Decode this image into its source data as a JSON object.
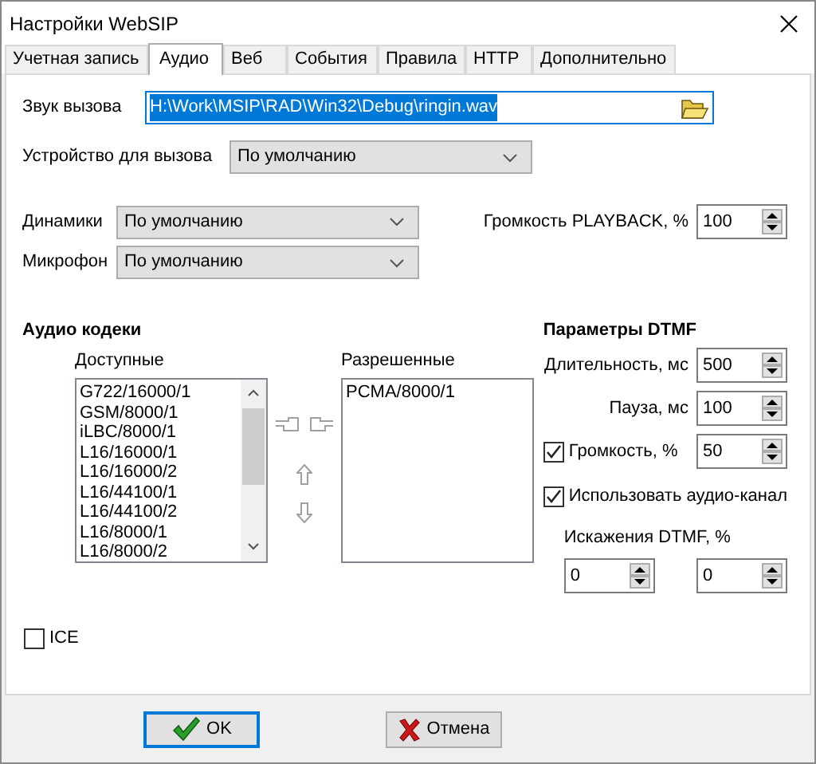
{
  "window": {
    "title": "Настройки WebSIP"
  },
  "tabs": [
    {
      "label": "Учетная запись",
      "selected": false
    },
    {
      "label": "Аудио",
      "selected": true
    },
    {
      "label": "Веб",
      "selected": false
    },
    {
      "label": "События",
      "selected": false
    },
    {
      "label": "Правила",
      "selected": false
    },
    {
      "label": "HTTP",
      "selected": false
    },
    {
      "label": "Дополнительно",
      "selected": false
    }
  ],
  "ring_sound": {
    "label": "Звук вызова",
    "value": "H:\\Work\\MSIP\\RAD\\Win32\\Debug\\ringin.wav",
    "selected": true
  },
  "ring_device": {
    "label": "Устройство для вызова",
    "value": "По умолчанию"
  },
  "speakers": {
    "label": "Динамики",
    "value": "По умолчанию"
  },
  "microphone": {
    "label": "Микрофон",
    "value": "По умолчанию"
  },
  "playback_volume": {
    "label": "Громкость PLAYBACK, %",
    "value": "100"
  },
  "codecs": {
    "title": "Аудио кодеки",
    "available": {
      "label": "Доступные",
      "items": [
        "G722/16000/1",
        "GSM/8000/1",
        "iLBC/8000/1",
        "L16/16000/1",
        "L16/16000/2",
        "L16/44100/1",
        "L16/44100/2",
        "L16/8000/1",
        "L16/8000/2"
      ]
    },
    "allowed": {
      "label": "Разрешенные",
      "items": [
        "PCMA/8000/1"
      ]
    }
  },
  "dtmf": {
    "title": "Параметры DTMF",
    "duration": {
      "label": "Длительность, мс",
      "value": "500"
    },
    "pause": {
      "label": "Пауза, мс",
      "value": "100"
    },
    "volume": {
      "label": "Громкость, %",
      "checked": true,
      "value": "50"
    },
    "use_audio_channel": {
      "label": "Использовать аудио-канал",
      "checked": true
    },
    "distortion": {
      "label": "Искажения DTMF, %",
      "values": [
        "0",
        "0"
      ]
    }
  },
  "ice": {
    "label": "ICE",
    "checked": false
  },
  "buttons": [
    {
      "label": "OK",
      "kind": "ok",
      "default": true
    },
    {
      "label": "Отмена",
      "kind": "cancel",
      "default": false
    }
  ]
}
